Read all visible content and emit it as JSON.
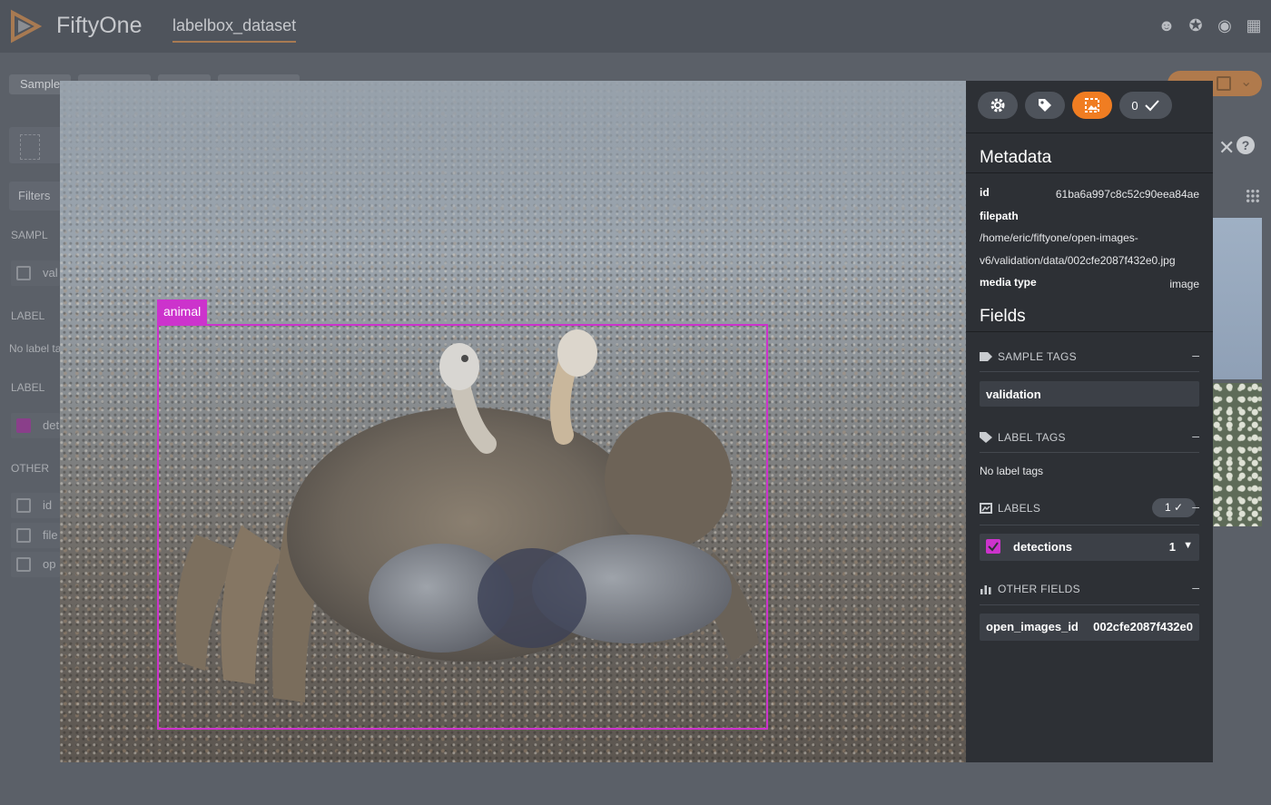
{
  "header": {
    "app_title": "FiftyOne",
    "dataset_name": "labelbox_dataset",
    "icons": [
      "team-icon",
      "slack-icon",
      "github-icon",
      "docs-icon"
    ]
  },
  "background": {
    "tabs": [
      "Sample",
      "",
      "",
      ""
    ],
    "filters_label": "Filters",
    "sections": [
      "SAMPL",
      "LABEL",
      "LABEL",
      "OTHER"
    ],
    "row_labels": [
      "val",
      "det",
      "id",
      "file",
      "op"
    ],
    "no_label_text": "No label ta"
  },
  "viewer": {
    "detection_label": "animal",
    "box_color": "#cc33cc"
  },
  "panel": {
    "toolbar": {
      "settings": "settings-icon",
      "tags": "tag-icon",
      "active": "image-icon",
      "selected_count": "0"
    },
    "metadata": {
      "title": "Metadata",
      "id_key": "id",
      "id_value": "61ba6a997c8c52c90eea84ae",
      "filepath_key": "filepath",
      "filepath_value": "/home/eric/fiftyone/open-images-v6/validation/data/002cfe2087f432e0.jpg",
      "media_type_key": "media type",
      "media_type_value": "image"
    },
    "fields": {
      "title": "Fields",
      "sample_tags_label": "SAMPLE TAGS",
      "sample_tag": "validation",
      "label_tags_label": "LABEL TAGS",
      "no_label_tags": "No label tags",
      "labels_label": "LABELS",
      "labels_count": "1",
      "detections_label": "detections",
      "detections_count": "1",
      "other_fields_label": "OTHER FIELDS",
      "open_images_id_key": "open_images_id",
      "open_images_id_value": "002cfe2087f432e0",
      "collapse_symbol": "–"
    }
  }
}
